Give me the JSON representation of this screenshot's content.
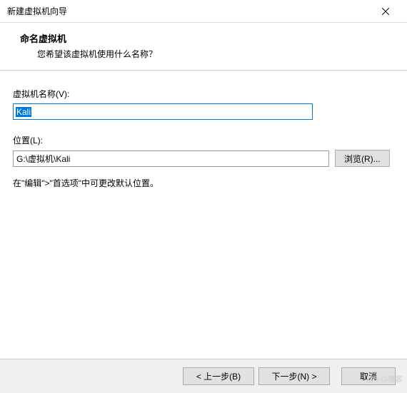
{
  "window": {
    "title": "新建虚拟机向导"
  },
  "header": {
    "title": "命名虚拟机",
    "subtitle": "您希望该虚拟机使用什么名称？"
  },
  "fields": {
    "name_label": "虚拟机名称(V):",
    "name_value": "Kali",
    "location_label": "位置(L):",
    "location_value": "G:\\虚拟机\\Kali",
    "browse_label": "浏览(R)..."
  },
  "hint": "在\"编辑\">\"首选项\"中可更改默认位置。",
  "buttons": {
    "back": "< 上一步(B)",
    "next": "下一步(N) >",
    "cancel": "取消"
  },
  "watermark": "@5  O博客"
}
